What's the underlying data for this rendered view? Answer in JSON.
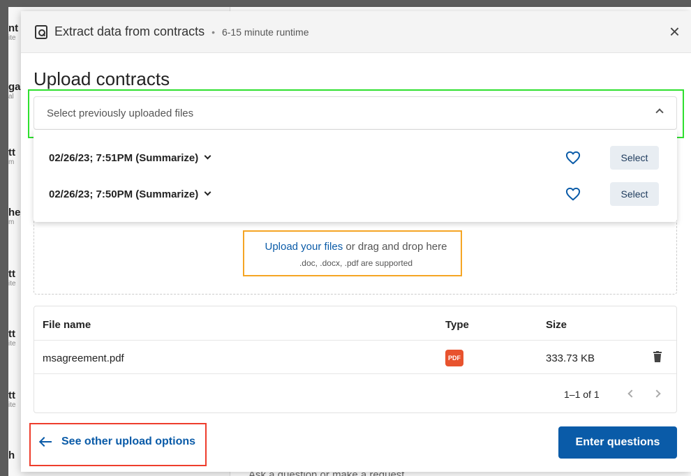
{
  "background": {
    "items": [
      {
        "title": "nt",
        "sub": "ite"
      },
      {
        "title": "ga",
        "sub": "al"
      },
      {
        "title": "tt",
        "sub": "m"
      },
      {
        "title": "he",
        "sub": "m"
      },
      {
        "title": "tt",
        "sub": "ite"
      },
      {
        "title": "tt",
        "sub": "ite"
      },
      {
        "title": "tt",
        "sub": "ite"
      },
      {
        "title": "h",
        "sub": ""
      }
    ],
    "bottom_text": "Ask a question or make a request"
  },
  "modal": {
    "title": "Extract data from contracts",
    "separator": "•",
    "runtime": "6-15 minute runtime",
    "close_label": "×"
  },
  "upload": {
    "title": "Upload contracts",
    "select_placeholder": "Select previously uploaded files",
    "previous": [
      {
        "label": "02/26/23; 7:51PM (Summarize)",
        "select_label": "Select"
      },
      {
        "label": "02/26/23; 7:50PM (Summarize)",
        "select_label": "Select"
      }
    ],
    "dropzone": {
      "link": "Upload your files",
      "text": " or drag and drop here",
      "supported": ".doc, .docx, .pdf are supported"
    }
  },
  "table": {
    "headers": {
      "name": "File name",
      "type": "Type",
      "size": "Size"
    },
    "rows": [
      {
        "name": "msagreement.pdf",
        "type_badge": "PDF",
        "size": "333.73 KB"
      }
    ],
    "pagination": "1–1 of 1"
  },
  "footer": {
    "back_label": "See other upload options",
    "primary_label": "Enter questions"
  },
  "colors": {
    "accent": "#0a5ba8",
    "pdf_badge": "#e8532e",
    "highlight_green": "#2ee02e",
    "highlight_orange": "#f5a524",
    "highlight_red": "#ee3d2c"
  }
}
